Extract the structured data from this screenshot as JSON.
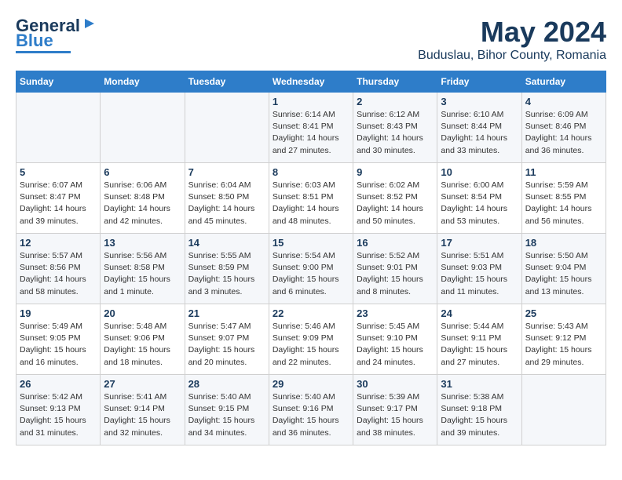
{
  "logo": {
    "line1": "General",
    "line2": "Blue"
  },
  "title": "May 2024",
  "location": "Buduslau, Bihor County, Romania",
  "weekdays": [
    "Sunday",
    "Monday",
    "Tuesday",
    "Wednesday",
    "Thursday",
    "Friday",
    "Saturday"
  ],
  "weeks": [
    [
      {
        "day": "",
        "info": ""
      },
      {
        "day": "",
        "info": ""
      },
      {
        "day": "",
        "info": ""
      },
      {
        "day": "1",
        "info": "Sunrise: 6:14 AM\nSunset: 8:41 PM\nDaylight: 14 hours\nand 27 minutes."
      },
      {
        "day": "2",
        "info": "Sunrise: 6:12 AM\nSunset: 8:43 PM\nDaylight: 14 hours\nand 30 minutes."
      },
      {
        "day": "3",
        "info": "Sunrise: 6:10 AM\nSunset: 8:44 PM\nDaylight: 14 hours\nand 33 minutes."
      },
      {
        "day": "4",
        "info": "Sunrise: 6:09 AM\nSunset: 8:46 PM\nDaylight: 14 hours\nand 36 minutes."
      }
    ],
    [
      {
        "day": "5",
        "info": "Sunrise: 6:07 AM\nSunset: 8:47 PM\nDaylight: 14 hours\nand 39 minutes."
      },
      {
        "day": "6",
        "info": "Sunrise: 6:06 AM\nSunset: 8:48 PM\nDaylight: 14 hours\nand 42 minutes."
      },
      {
        "day": "7",
        "info": "Sunrise: 6:04 AM\nSunset: 8:50 PM\nDaylight: 14 hours\nand 45 minutes."
      },
      {
        "day": "8",
        "info": "Sunrise: 6:03 AM\nSunset: 8:51 PM\nDaylight: 14 hours\nand 48 minutes."
      },
      {
        "day": "9",
        "info": "Sunrise: 6:02 AM\nSunset: 8:52 PM\nDaylight: 14 hours\nand 50 minutes."
      },
      {
        "day": "10",
        "info": "Sunrise: 6:00 AM\nSunset: 8:54 PM\nDaylight: 14 hours\nand 53 minutes."
      },
      {
        "day": "11",
        "info": "Sunrise: 5:59 AM\nSunset: 8:55 PM\nDaylight: 14 hours\nand 56 minutes."
      }
    ],
    [
      {
        "day": "12",
        "info": "Sunrise: 5:57 AM\nSunset: 8:56 PM\nDaylight: 14 hours\nand 58 minutes."
      },
      {
        "day": "13",
        "info": "Sunrise: 5:56 AM\nSunset: 8:58 PM\nDaylight: 15 hours\nand 1 minute."
      },
      {
        "day": "14",
        "info": "Sunrise: 5:55 AM\nSunset: 8:59 PM\nDaylight: 15 hours\nand 3 minutes."
      },
      {
        "day": "15",
        "info": "Sunrise: 5:54 AM\nSunset: 9:00 PM\nDaylight: 15 hours\nand 6 minutes."
      },
      {
        "day": "16",
        "info": "Sunrise: 5:52 AM\nSunset: 9:01 PM\nDaylight: 15 hours\nand 8 minutes."
      },
      {
        "day": "17",
        "info": "Sunrise: 5:51 AM\nSunset: 9:03 PM\nDaylight: 15 hours\nand 11 minutes."
      },
      {
        "day": "18",
        "info": "Sunrise: 5:50 AM\nSunset: 9:04 PM\nDaylight: 15 hours\nand 13 minutes."
      }
    ],
    [
      {
        "day": "19",
        "info": "Sunrise: 5:49 AM\nSunset: 9:05 PM\nDaylight: 15 hours\nand 16 minutes."
      },
      {
        "day": "20",
        "info": "Sunrise: 5:48 AM\nSunset: 9:06 PM\nDaylight: 15 hours\nand 18 minutes."
      },
      {
        "day": "21",
        "info": "Sunrise: 5:47 AM\nSunset: 9:07 PM\nDaylight: 15 hours\nand 20 minutes."
      },
      {
        "day": "22",
        "info": "Sunrise: 5:46 AM\nSunset: 9:09 PM\nDaylight: 15 hours\nand 22 minutes."
      },
      {
        "day": "23",
        "info": "Sunrise: 5:45 AM\nSunset: 9:10 PM\nDaylight: 15 hours\nand 24 minutes."
      },
      {
        "day": "24",
        "info": "Sunrise: 5:44 AM\nSunset: 9:11 PM\nDaylight: 15 hours\nand 27 minutes."
      },
      {
        "day": "25",
        "info": "Sunrise: 5:43 AM\nSunset: 9:12 PM\nDaylight: 15 hours\nand 29 minutes."
      }
    ],
    [
      {
        "day": "26",
        "info": "Sunrise: 5:42 AM\nSunset: 9:13 PM\nDaylight: 15 hours\nand 31 minutes."
      },
      {
        "day": "27",
        "info": "Sunrise: 5:41 AM\nSunset: 9:14 PM\nDaylight: 15 hours\nand 32 minutes."
      },
      {
        "day": "28",
        "info": "Sunrise: 5:40 AM\nSunset: 9:15 PM\nDaylight: 15 hours\nand 34 minutes."
      },
      {
        "day": "29",
        "info": "Sunrise: 5:40 AM\nSunset: 9:16 PM\nDaylight: 15 hours\nand 36 minutes."
      },
      {
        "day": "30",
        "info": "Sunrise: 5:39 AM\nSunset: 9:17 PM\nDaylight: 15 hours\nand 38 minutes."
      },
      {
        "day": "31",
        "info": "Sunrise: 5:38 AM\nSunset: 9:18 PM\nDaylight: 15 hours\nand 39 minutes."
      },
      {
        "day": "",
        "info": ""
      }
    ]
  ]
}
